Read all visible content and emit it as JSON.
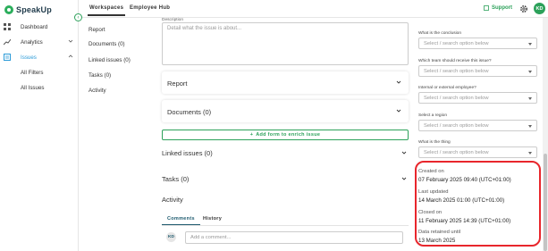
{
  "brand": {
    "name": "SpeakUp"
  },
  "nav": {
    "dashboard": "Dashboard",
    "analytics": "Analytics",
    "issues": "Issues",
    "all_filters": "All Filters",
    "all_issues": "All Issues"
  },
  "topbar": {
    "tab_workspaces": "Workspaces",
    "tab_employee_hub": "Employee Hub",
    "support": "Support",
    "user_initials": "KD"
  },
  "anchors": [
    "Report",
    "Documents (0)",
    "Linked issues (0)",
    "Tasks (0)",
    "Activity"
  ],
  "main": {
    "description_label": "Description",
    "description_placeholder": "Detail what the issue is about...",
    "report_title": "Report",
    "documents_title": "Documents (0)",
    "enrich_button": "Add form to enrich issue",
    "linked_issues_title": "Linked issues (0)",
    "tasks_title": "Tasks (0)",
    "activity_title": "Activity",
    "tab_comments": "Comments",
    "tab_history": "History",
    "commenter_initials": "KD",
    "comment_placeholder": "Add a comment..."
  },
  "right": {
    "fields": [
      {
        "label": "What is the conclusion",
        "placeholder": "Select / search option below"
      },
      {
        "label": "Which team should receive this issue?",
        "placeholder": "Select / search option below"
      },
      {
        "label": "Internal or external employee?",
        "placeholder": "Select / search option below"
      },
      {
        "label": "Select a region",
        "placeholder": "Select / search option below"
      },
      {
        "label": "What is the thing",
        "placeholder": "Select / search option below"
      }
    ],
    "meta": {
      "created_label": "Created on",
      "created_value": "07 February 2025 09:40 (UTC+01:00)",
      "updated_label": "Last updated",
      "updated_value": "14 March 2025 01:00 (UTC+01:00)",
      "closed_label": "Closed on",
      "closed_value": "11 February 2025 14:39 (UTC+01:00)",
      "retained_label": "Data retained until",
      "retained_value": "13 March 2025"
    }
  },
  "colors": {
    "brand_green": "#2ca15a",
    "highlight_red": "#e8262c",
    "active_blue": "#2c9bd8"
  }
}
